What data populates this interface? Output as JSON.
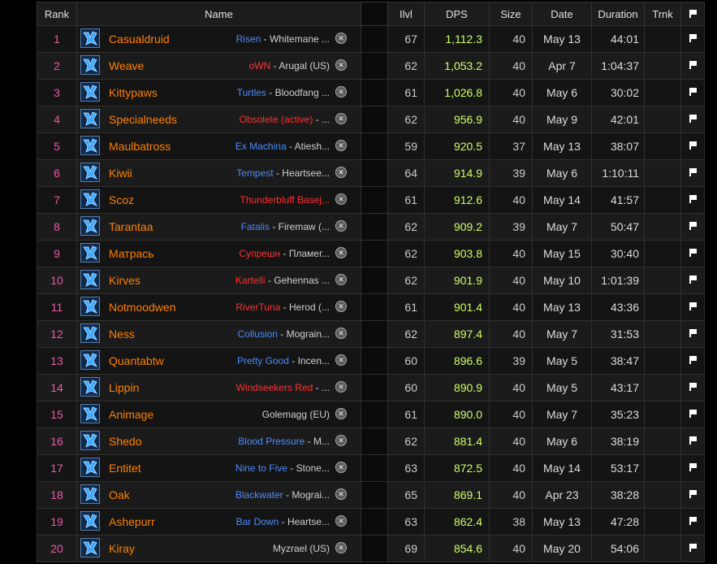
{
  "headers": {
    "rank": "Rank",
    "name": "Name",
    "ilvl": "Ilvl",
    "dps": "DPS",
    "size": "Size",
    "date": "Date",
    "duration": "Duration",
    "trnk": "Trnk"
  },
  "colors": {
    "player": "#ff8000",
    "rank": "#e85aa7",
    "dps": "#ccff66",
    "alliance_guild": "#4a8cff",
    "horde_guild": "#ff3030"
  },
  "rows": [
    {
      "rank": "1",
      "name": "Casualdruid",
      "guild": "Risen",
      "guild_color": "#4a8cff",
      "realm": "Whitemane ...",
      "ilvl": "67",
      "dps": "1,112.3",
      "size": "40",
      "date": "May 13",
      "duration": "44:01"
    },
    {
      "rank": "2",
      "name": "Weave",
      "guild": "oWN",
      "guild_color": "#ff3030",
      "realm": "Arugal (US)",
      "ilvl": "62",
      "dps": "1,053.2",
      "size": "40",
      "date": "Apr 7",
      "duration": "1:04:37"
    },
    {
      "rank": "3",
      "name": "Kittypaws",
      "guild": "Turtles",
      "guild_color": "#4a8cff",
      "realm": "Bloodfang ...",
      "ilvl": "61",
      "dps": "1,026.8",
      "size": "40",
      "date": "May 6",
      "duration": "30:02"
    },
    {
      "rank": "4",
      "name": "Specialneeds",
      "guild": "Obsolete (active)",
      "guild_color": "#ff3030",
      "realm": "...",
      "ilvl": "62",
      "dps": "956.9",
      "size": "40",
      "date": "May 9",
      "duration": "42:01"
    },
    {
      "rank": "5",
      "name": "Maulbatross",
      "guild": "Ex Machina",
      "guild_color": "#4a8cff",
      "realm": "Atiesh...",
      "ilvl": "59",
      "dps": "920.5",
      "size": "37",
      "date": "May 13",
      "duration": "38:07"
    },
    {
      "rank": "6",
      "name": "Kiwii",
      "guild": "Tempest",
      "guild_color": "#4a8cff",
      "realm": "Heartsee...",
      "ilvl": "64",
      "dps": "914.9",
      "size": "39",
      "date": "May 6",
      "duration": "1:10:11"
    },
    {
      "rank": "7",
      "name": "Scoz",
      "guild": "Thunderbluff Basej...",
      "guild_color": "#ff3030",
      "realm": "",
      "ilvl": "61",
      "dps": "912.6",
      "size": "40",
      "date": "May 14",
      "duration": "41:57"
    },
    {
      "rank": "8",
      "name": "Tarantaa",
      "guild": "Fatalis",
      "guild_color": "#4a8cff",
      "realm": "Firemaw (...",
      "ilvl": "62",
      "dps": "909.2",
      "size": "39",
      "date": "May 7",
      "duration": "50:47"
    },
    {
      "rank": "9",
      "name": "Матрась",
      "guild": "Супрешн",
      "guild_color": "#ff3030",
      "realm": "Пламег...",
      "ilvl": "62",
      "dps": "903.8",
      "size": "40",
      "date": "May 15",
      "duration": "30:40"
    },
    {
      "rank": "10",
      "name": "Kirves",
      "guild": "Kartelli",
      "guild_color": "#ff3030",
      "realm": "Gehennas ...",
      "ilvl": "62",
      "dps": "901.9",
      "size": "40",
      "date": "May 10",
      "duration": "1:01:39"
    },
    {
      "rank": "11",
      "name": "Notmoodwen",
      "guild": "RiverTuna",
      "guild_color": "#ff3030",
      "realm": "Herod (...",
      "ilvl": "61",
      "dps": "901.4",
      "size": "40",
      "date": "May 13",
      "duration": "43:36"
    },
    {
      "rank": "12",
      "name": "Ness",
      "guild": "Collusion",
      "guild_color": "#4a8cff",
      "realm": "Mograin...",
      "ilvl": "62",
      "dps": "897.4",
      "size": "40",
      "date": "May 7",
      "duration": "31:53"
    },
    {
      "rank": "13",
      "name": "Quantabtw",
      "guild": "Pretty Good",
      "guild_color": "#4a8cff",
      "realm": "Incen...",
      "ilvl": "60",
      "dps": "896.6",
      "size": "39",
      "date": "May 5",
      "duration": "38:47"
    },
    {
      "rank": "14",
      "name": "Lippin",
      "guild": "Windseekers Red",
      "guild_color": "#ff3030",
      "realm": "...",
      "ilvl": "60",
      "dps": "890.9",
      "size": "40",
      "date": "May 5",
      "duration": "43:17"
    },
    {
      "rank": "15",
      "name": "Animage",
      "guild": "",
      "guild_color": "#4a8cff",
      "realm": "Golemagg (EU)",
      "ilvl": "61",
      "dps": "890.0",
      "size": "40",
      "date": "May 7",
      "duration": "35:23"
    },
    {
      "rank": "16",
      "name": "Shedo",
      "guild": "Blood Pressure",
      "guild_color": "#4a8cff",
      "realm": "M...",
      "ilvl": "62",
      "dps": "881.4",
      "size": "40",
      "date": "May 6",
      "duration": "38:19"
    },
    {
      "rank": "17",
      "name": "Entitet",
      "guild": "Nine to Five",
      "guild_color": "#4a8cff",
      "realm": "Stone...",
      "ilvl": "63",
      "dps": "872.5",
      "size": "40",
      "date": "May 14",
      "duration": "53:17"
    },
    {
      "rank": "18",
      "name": "Oak",
      "guild": "Blackwater",
      "guild_color": "#4a8cff",
      "realm": "Mograi...",
      "ilvl": "65",
      "dps": "869.1",
      "size": "40",
      "date": "Apr 23",
      "duration": "38:28"
    },
    {
      "rank": "19",
      "name": "Ashepurr",
      "guild": "Bar Down",
      "guild_color": "#4a8cff",
      "realm": "Heartse...",
      "ilvl": "63",
      "dps": "862.4",
      "size": "38",
      "date": "May 13",
      "duration": "47:28"
    },
    {
      "rank": "20",
      "name": "Kiray",
      "guild": "",
      "guild_color": "#4a8cff",
      "realm": "Myzrael (US)",
      "ilvl": "69",
      "dps": "854.6",
      "size": "40",
      "date": "May 20",
      "duration": "54:06"
    }
  ]
}
